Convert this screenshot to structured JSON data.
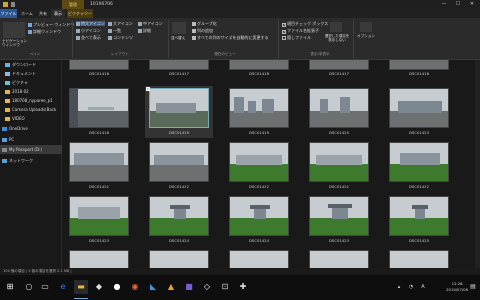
{
  "titlebar": {
    "context_tab": "管理",
    "window_title": "10190706",
    "min": "—",
    "max": "☐",
    "close": "✕"
  },
  "tabs": [
    {
      "label": "ファイル"
    },
    {
      "label": "ホーム"
    },
    {
      "label": "共有"
    },
    {
      "label": "表示"
    },
    {
      "label": "ピクチャツール"
    }
  ],
  "ribbon": {
    "nav_pane": "ナビゲーション\nウィンドウ",
    "preview_pane": "プレビュー ウィンドウ",
    "details_pane": "詳細ウィンドウ",
    "pane_group": "ペイン",
    "layout": [
      "特大アイコン",
      "大アイコン",
      "中アイコン",
      "小アイコン",
      "一覧",
      "詳細",
      "並べて表示",
      "コンテンツ"
    ],
    "layout_group": "レイアウト",
    "sort": "並べ替え",
    "group_by": "グループ化",
    "add_columns": "列の追加",
    "fit_columns": "すべての列のサイズを自動的に変更する",
    "current_view_group": "現在のビュー",
    "item_checkbox": "項目チェック ボックス",
    "file_ext": "ファイル名拡張子",
    "hidden_items": "隠しファイル",
    "hide_selected": "選択した項目を表示しない",
    "show_hide_group": "表示/非表示",
    "options": "オプション"
  },
  "nav": [
    {
      "label": "ダウンロード",
      "icon": "download-icon"
    },
    {
      "label": "ドキュメント",
      "icon": "document-icon"
    },
    {
      "label": "ピクチャ",
      "icon": "picture-icon"
    },
    {
      "label": "2018-02",
      "icon": "folder-icon"
    },
    {
      "label": "180708_nyparee_p1",
      "icon": "folder-icon"
    },
    {
      "label": "Camera Uploads(Back",
      "icon": "folder-icon"
    },
    {
      "label": "VIDEO",
      "icon": "folder-icon"
    },
    {
      "label": "OneDrive",
      "icon": "onedrive-icon"
    },
    {
      "label": "PC",
      "icon": "pc-icon"
    },
    {
      "label": "My Passport (D:)",
      "icon": "drive-icon"
    },
    {
      "label": "ネットワーク",
      "icon": "network-icon"
    }
  ],
  "files": [
    [
      "DSC01416",
      "DSC01417",
      "DSC01418",
      "DSC01417",
      "DSC01416",
      "DSC01417"
    ],
    [
      "DSC01418",
      "DSC01419",
      "DSC01419",
      "DSC01420",
      "DSC01423"
    ],
    [
      "DSC01421",
      "DSC01422",
      "DSC01422",
      "DSC01421",
      "DSC01422"
    ],
    [
      "DSC01423",
      "DSC01424",
      "DSC01424",
      "DSC01423",
      "DSC01425"
    ]
  ],
  "status": "104 個の項目  |  1 個の項目を選択  2.1 MB  |",
  "clock": {
    "time": "12:28",
    "date": "2019/07/06"
  }
}
